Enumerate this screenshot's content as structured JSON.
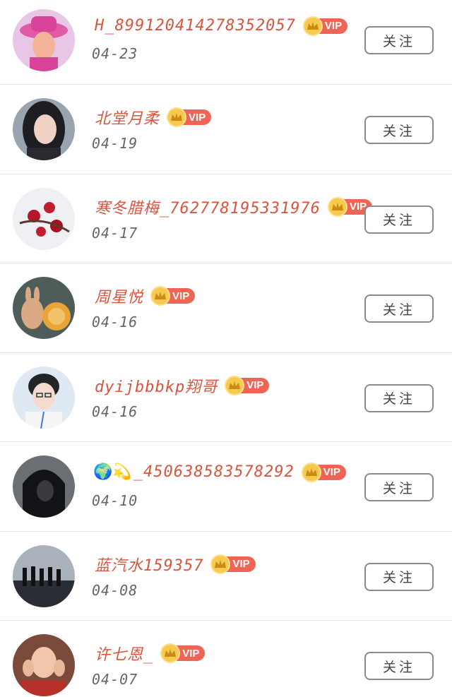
{
  "follow_label": "关注",
  "vip_label": "VIP",
  "colors": {
    "name": "#d8553f",
    "vip_badge": "#ef6455",
    "crown": "#f7c94d",
    "date": "#666666",
    "divider": "#e4e4e4"
  },
  "users": [
    {
      "prefix": "",
      "name": "H_89912041427835205​7",
      "date": "04-23",
      "avatar": "cartoon-woman-pink-hat"
    },
    {
      "prefix": "",
      "name": "北堂月柔",
      "date": "04-19",
      "avatar": "dark-hair-woman-portrait"
    },
    {
      "prefix": "",
      "name": "寒冬腊梅_762778195331976",
      "date": "04-17",
      "avatar": "red-plum-blossoms-snow"
    },
    {
      "prefix": "",
      "name": "周星悦",
      "date": "04-16",
      "avatar": "plush-bear-toys"
    },
    {
      "prefix": "",
      "name": "dyijbbbkp翔哥",
      "date": "04-16",
      "avatar": "young-man-glasses"
    },
    {
      "prefix": "🌍💫",
      "name": "_450638583578292",
      "date": "04-10",
      "avatar": "hooded-figure-dark"
    },
    {
      "prefix": "",
      "name": "蓝汽水159357",
      "date": "04-08",
      "avatar": "silhouettes-beach"
    },
    {
      "prefix": "",
      "name": "许七恩_",
      "date": "04-07",
      "avatar": "girl-hands-on-cheeks"
    }
  ]
}
